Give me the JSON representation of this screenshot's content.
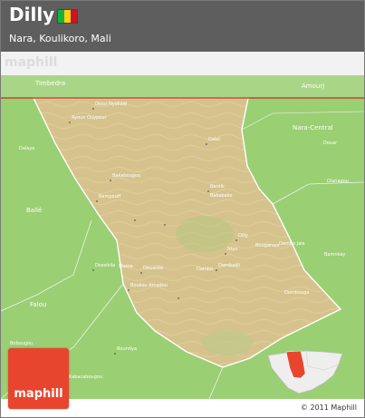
{
  "header": {
    "title": "Dilly",
    "subtitle": "Nara, Koulikoro, Mali",
    "flag_colors": [
      "#14b53a",
      "#fcd116",
      "#ce1126"
    ]
  },
  "watermark": "maphill",
  "map": {
    "region_name": "Dilly",
    "colors": {
      "green": "#9fd27a",
      "desert": "#d6c28c",
      "border_national": "#c2462f",
      "border_region": "#ffffff"
    },
    "labels_large": [
      "Timbedra",
      "Amourj",
      "Nara-Central",
      "Ballé",
      "Falou"
    ],
    "labels_small": [
      "Diour Nyakalé",
      "Ayoun Ouypour",
      "Dalaye",
      "Dalal",
      "Douar",
      "Bakabougou",
      "Bantik",
      "Bampouff",
      "Bakabako",
      "Dianagou",
      "Dilly",
      "Niyo",
      "Bougarssa",
      "Dambadji",
      "Douanke",
      "Dambo Jala",
      "Bamnkay",
      "Dossikila",
      "Massa",
      "Dambo",
      "Dembouga",
      "Boukou Amadou",
      "Bobougou",
      "Bourolya",
      "Kabacabougou"
    ]
  },
  "logo_text": "maphill",
  "copyright": "© 2011 Maphill"
}
